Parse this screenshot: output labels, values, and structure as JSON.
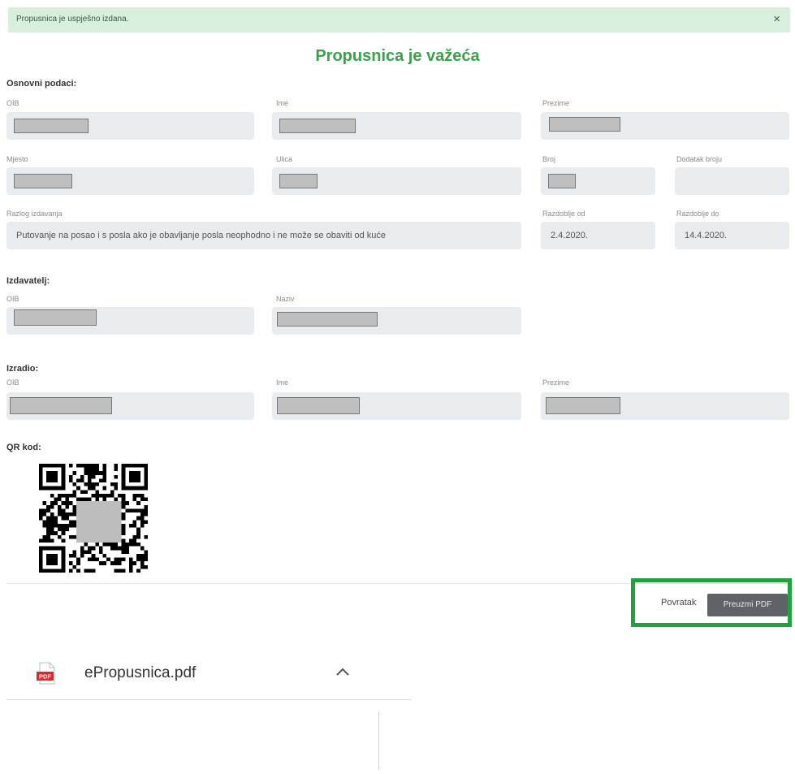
{
  "alert": {
    "message": "Propusnica je uspješno izdana.",
    "close_label": "×"
  },
  "page_title": "Propusnica je važeća",
  "basic": {
    "title": "Osnovni podaci:",
    "labels": {
      "oib": "OIB",
      "ime": "Ime",
      "prezime": "Prezime",
      "mjesto": "Mjesto",
      "ulica": "Ulica",
      "broj": "Broj",
      "dodatak": "Dodatak broju",
      "razlog": "Razlog izdavanja",
      "od": "Razdoblje od",
      "do": "Razdoblje do"
    },
    "values": {
      "razlog": "Putovanje na posao i s posla ako je obavljanje posla neophodno i ne može se obaviti od kuće",
      "od": "2.4.2020.",
      "do": "14.4.2020."
    }
  },
  "issuer": {
    "title": "Izdavatelj:",
    "labels": {
      "oib": "OIB",
      "naziv": "Naziv"
    }
  },
  "creator": {
    "title": "Izradio:",
    "labels": {
      "oib": "OIB",
      "ime": "Ime",
      "prezime": "Prezime"
    }
  },
  "qr": {
    "title": "QR kod:"
  },
  "actions": {
    "back": "Povratak",
    "download": "Preuzmi PDF"
  },
  "download_bar": {
    "filename": "ePropusnica.pdf",
    "icon_text": "PDF",
    "chevron": "^",
    "icon": "pdf-file-icon"
  },
  "colors": {
    "accent": "#3aa14c",
    "alert_bg": "#d7efdc",
    "highlight": "#20a33e",
    "button_bg": "#5f6368"
  }
}
